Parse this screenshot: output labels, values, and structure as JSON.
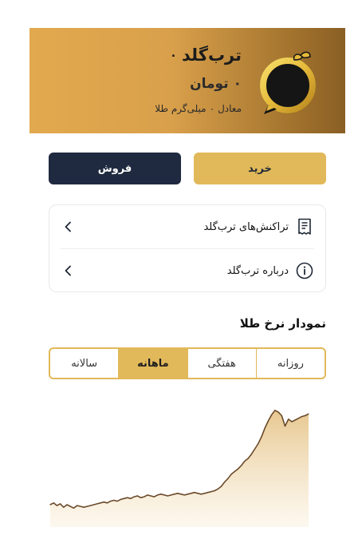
{
  "hero": {
    "title": "ترب‌گلد",
    "balance": "۰",
    "amount_value": "۰",
    "amount_unit": "تومان",
    "equiv_prefix": "معادل",
    "equiv_value": "۰",
    "equiv_unit": "میلی‌گرم طلا",
    "logo_icon": "torobgold-ring-logo-icon"
  },
  "actions": {
    "buy_label": "خرید",
    "sell_label": "فروش",
    "buy_color": "#e1b95a",
    "sell_color": "#1f2a40"
  },
  "menu": {
    "items": [
      {
        "label": "تراکنش‌های ترب‌گلد",
        "icon": "receipt-icon"
      },
      {
        "label": "درباره ترب‌گلد",
        "icon": "info-icon"
      }
    ]
  },
  "chart_section": {
    "title": "نمودار نرخ طلا",
    "tabs": [
      {
        "label": "روزانه",
        "active": false
      },
      {
        "label": "هفتگی",
        "active": false
      },
      {
        "label": "ماهانه",
        "active": true
      },
      {
        "label": "سالانه",
        "active": false
      }
    ]
  },
  "chart_data": {
    "type": "area",
    "title": "",
    "xlabel": "",
    "ylabel": "",
    "grid": false,
    "legend": "none",
    "line_color": "#6b4a2a",
    "fill_color": "#ecd3a0",
    "y": [
      22,
      24,
      21,
      23,
      19,
      22,
      20,
      18,
      21,
      20,
      19,
      20,
      21,
      22,
      23,
      24,
      25,
      24,
      26,
      27,
      26,
      28,
      29,
      30,
      29,
      31,
      32,
      30,
      31,
      33,
      32,
      31,
      33,
      34,
      33,
      32,
      33,
      34,
      35,
      34,
      33,
      34,
      35,
      36,
      35,
      34,
      35,
      36,
      37,
      38,
      40,
      43,
      48,
      52,
      57,
      60,
      63,
      67,
      72,
      75,
      80,
      86,
      92,
      100,
      110,
      118,
      125,
      130,
      128,
      124,
      112,
      120,
      117,
      119,
      121,
      123,
      124,
      126
    ],
    "ylim": [
      0,
      140
    ]
  }
}
